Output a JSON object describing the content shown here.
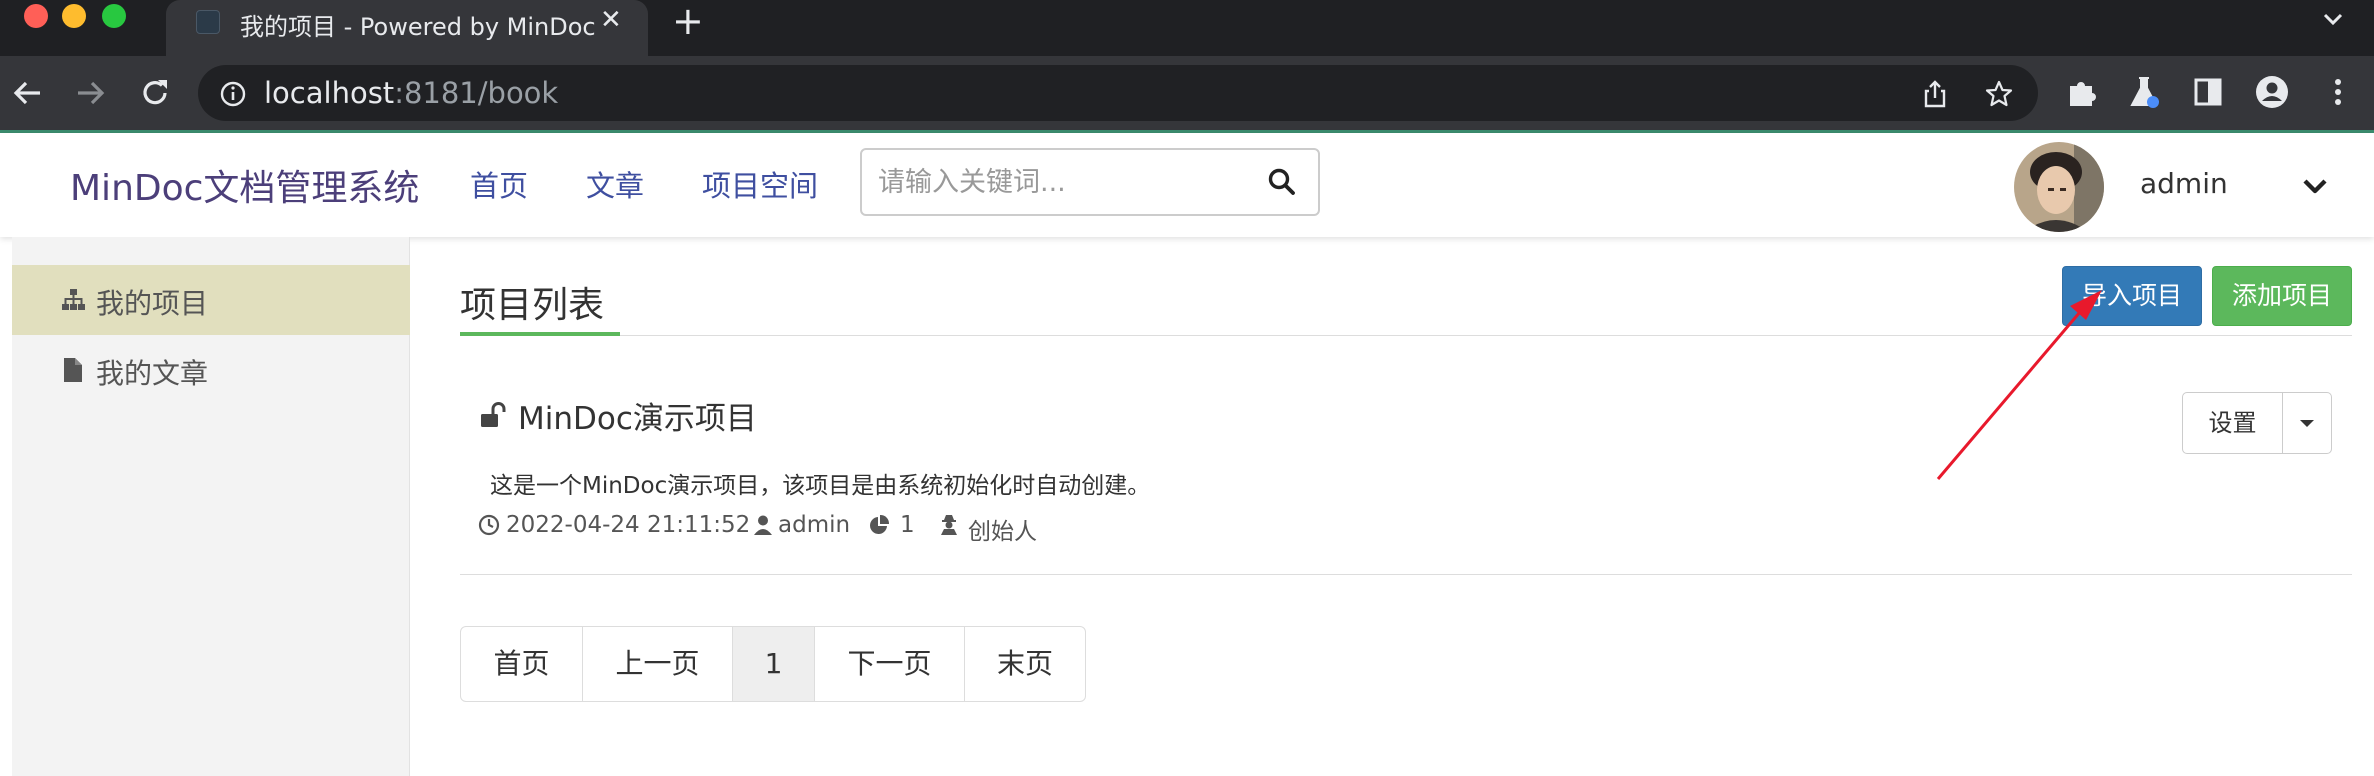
{
  "browser": {
    "tab_title": "我的项目 - Powered by MinDoc",
    "url_host": "localhost",
    "url_rest": ":8181/book",
    "colors": {
      "chrome_dark": "#1f2023",
      "chrome_toolbar": "#35363a",
      "omnibox": "#202124"
    }
  },
  "header": {
    "brand": "MinDoc文档管理系统",
    "nav": [
      "首页",
      "文章",
      "项目空间"
    ],
    "search_placeholder": "请输入关键词...",
    "username": "admin"
  },
  "sidebar": {
    "items": [
      {
        "label": "我的项目",
        "icon": "sitemap-icon",
        "active": true
      },
      {
        "label": "我的文章",
        "icon": "file-icon",
        "active": false
      }
    ]
  },
  "main": {
    "title": "项目列表",
    "import_button": "导入项目",
    "add_button": "添加项目",
    "project": {
      "name": "MinDoc演示项目",
      "description": "这是一个MinDoc演示项目，该项目是由系统初始化时自动创建。",
      "created": "2022-04-24 21:11:52",
      "author": "admin",
      "doc_count": "1",
      "role": "创始人",
      "settings_label": "设置"
    },
    "pagination": [
      "首页",
      "上一页",
      "1",
      "下一页",
      "末页"
    ],
    "colors": {
      "primary": "#337ab7",
      "success": "#5cb85c",
      "brand": "#4c3f7a",
      "nav": "#3f4fa0",
      "sidebar_active": "#e1dfbe",
      "annotation_arrow": "#e8192c"
    }
  }
}
